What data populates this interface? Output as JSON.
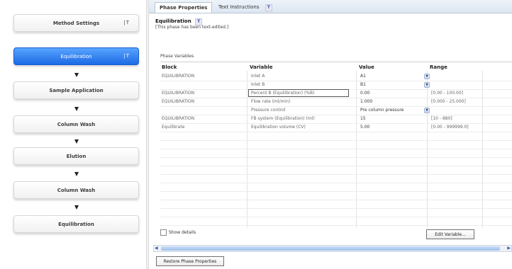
{
  "method_pane": {
    "steps": [
      {
        "label": "Method Settings",
        "text_icon": "T"
      },
      {
        "label": "Equilibration",
        "text_icon": "T",
        "active": true
      },
      {
        "label": "Sample Application"
      },
      {
        "label": "Column Wash"
      },
      {
        "label": "Elution"
      },
      {
        "label": "Column Wash"
      },
      {
        "label": "Equilibration"
      }
    ]
  },
  "tabs": {
    "phase_properties": "Phase Properties",
    "text_instructions": "Text Instructions",
    "t_badge": "T"
  },
  "phase": {
    "title": "Equilibration",
    "t_badge": "T",
    "subtitle": "[This phase has been text-edited.]"
  },
  "phase_variables_label": "Phase Variables",
  "table": {
    "headers": {
      "block": "Block",
      "variable": "Variable",
      "value": "Value",
      "range": "Range"
    },
    "rows": [
      {
        "block": "EQUILIBRATION",
        "variable": "Inlet A",
        "value": "A1",
        "range": "",
        "dropdown": true
      },
      {
        "block": "",
        "variable": "Inlet B",
        "value": "B1",
        "range": "",
        "dropdown": true
      },
      {
        "block": "EQUILIBRATION",
        "variable": "Percent B (Equilibration) (%B)",
        "value": "0.00",
        "range": "[0.00 - 100.00]",
        "editing": true
      },
      {
        "block": "EQUILIBRATION",
        "variable": "Flow rate (ml/min)",
        "value": "1.000",
        "range": "[0.000 - 25.000]"
      },
      {
        "block": "",
        "variable": "Pressure control",
        "value": "Pre column pressure",
        "range": "",
        "dropdown": true
      },
      {
        "block": "EQUILIBRATION",
        "variable": "FB system (Equilibration) (ml)",
        "value": "15",
        "range": "[10 - 880]"
      },
      {
        "block": "Equilibrate",
        "variable": "Equilibration volume (CV)",
        "value": "5.00",
        "range": "[0.00 - 999999.0]"
      }
    ]
  },
  "show_details": "Show details",
  "edit_variable_button": "Edit Variable...",
  "restore_button": "Restore Phase Properties",
  "icons": {
    "dropdown": "chevron-down-icon",
    "arrow": "arrow-down-icon"
  }
}
